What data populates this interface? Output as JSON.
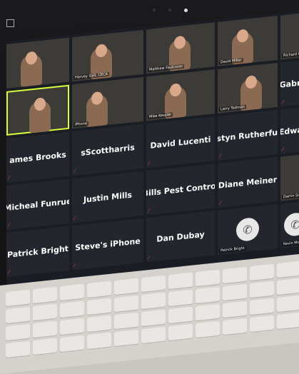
{
  "screen": {
    "tiles": [
      {
        "kind": "video",
        "caption": "",
        "label": ""
      },
      {
        "kind": "video",
        "caption": "Harvey Gall, CECA",
        "label": ""
      },
      {
        "kind": "video",
        "caption": "Matthew Faulconer",
        "label": ""
      },
      {
        "kind": "video",
        "caption": "David Miller",
        "label": ""
      },
      {
        "kind": "video",
        "caption": "Richard Gallagher",
        "label": ""
      },
      {
        "kind": "video",
        "caption": "",
        "label": "",
        "active": true
      },
      {
        "kind": "video",
        "caption": "iPhone",
        "label": ""
      },
      {
        "kind": "video",
        "caption": "Mike Kessler",
        "label": ""
      },
      {
        "kind": "video",
        "caption": "Larry Todman",
        "label": ""
      },
      {
        "kind": "name",
        "caption": "",
        "label": "Gabriel"
      },
      {
        "kind": "name",
        "caption": "",
        "label": "ames Brooks"
      },
      {
        "kind": "name",
        "caption": "",
        "label": "sScottharris"
      },
      {
        "kind": "name",
        "caption": "",
        "label": "David Lucenti"
      },
      {
        "kind": "name",
        "caption": "",
        "label": "Justyn Rutherfurd"
      },
      {
        "kind": "name",
        "caption": "",
        "label": "Edward"
      },
      {
        "kind": "name",
        "caption": "",
        "label": "Micheal Funrue"
      },
      {
        "kind": "name",
        "caption": "",
        "label": "Justin Mills"
      },
      {
        "kind": "name",
        "caption": "",
        "label": "Bills Pest Control"
      },
      {
        "kind": "name",
        "caption": "",
        "label": "Diane Meiner"
      },
      {
        "kind": "video",
        "caption": "Darrin Smith",
        "label": ""
      },
      {
        "kind": "name",
        "caption": "",
        "label": "Patrick Bright"
      },
      {
        "kind": "name",
        "caption": "",
        "label": "Steve's iPhone"
      },
      {
        "kind": "name",
        "caption": "",
        "label": "Dan Dubay"
      },
      {
        "kind": "phone",
        "caption": "Patrick Bright",
        "label": ""
      },
      {
        "kind": "phone",
        "caption": "Kevin McFarland",
        "label": ""
      }
    ]
  }
}
